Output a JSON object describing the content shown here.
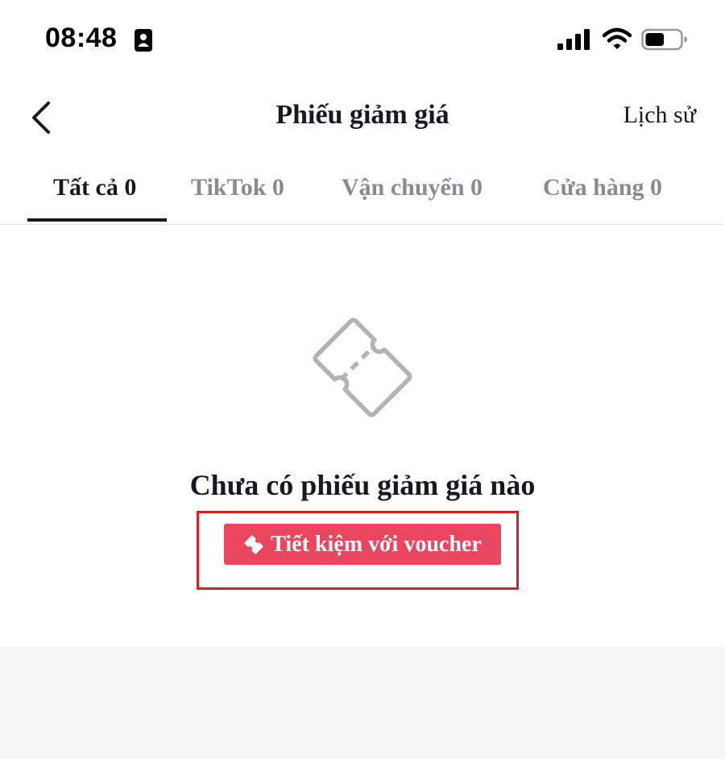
{
  "status_bar": {
    "time": "08:48",
    "icons": [
      "id-card-icon",
      "signal-icon",
      "wifi-icon",
      "battery-icon"
    ],
    "battery_level": 0.55
  },
  "nav": {
    "back_icon": "chevron-left-icon",
    "title": "Phiếu giảm giá",
    "history_label": "Lịch sử"
  },
  "tabs": [
    {
      "label": "Tất cả 0",
      "active": true
    },
    {
      "label": "TikTok 0",
      "active": false
    },
    {
      "label": "Vận chuyển 0",
      "active": false
    },
    {
      "label": "Cửa hàng 0",
      "active": false
    }
  ],
  "empty_state": {
    "icon": "ticket-icon",
    "message": "Chưa có phiếu giảm giá nào",
    "button_label": "Tiết kiệm với voucher",
    "button_icon": "ticket-icon"
  },
  "colors": {
    "text_primary": "#161823",
    "text_inactive": "#8a8b91",
    "button_bg": "#e9465f",
    "highlight_border": "#d7202e",
    "icon_gray": "#b3b3b6",
    "bottom_bg": "#f6f6f7"
  }
}
